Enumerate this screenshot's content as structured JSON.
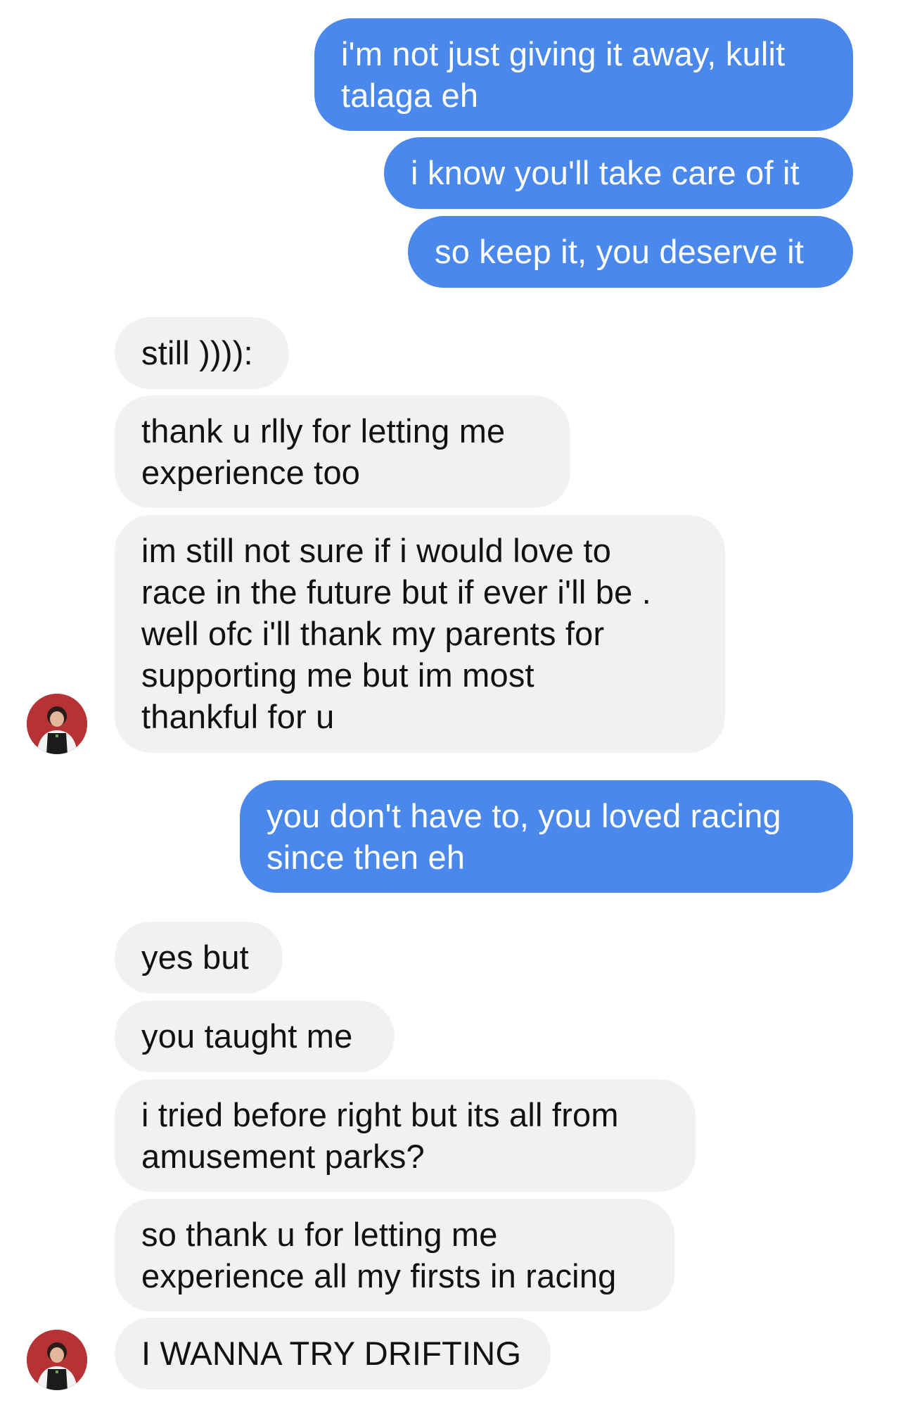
{
  "chat": {
    "messages": [
      {
        "side": "sent",
        "text": "i'm not just giving it away, kulit\ntalaga eh"
      },
      {
        "side": "sent",
        "text": "i know you'll take care of it"
      },
      {
        "side": "sent",
        "text": "so keep it, you deserve it"
      },
      {
        "side": "received",
        "text": "still )))):"
      },
      {
        "side": "received",
        "text": "thank u rlly for letting me\nexperience too"
      },
      {
        "side": "received",
        "text": "im still not sure if i would love to\nrace in the future but if ever i'll be .\nwell ofc i'll thank my parents for\nsupporting me but im most\nthankful for u"
      },
      {
        "side": "sent",
        "text": "you don't have to, you loved racing\nsince then eh"
      },
      {
        "side": "received",
        "text": "yes but"
      },
      {
        "side": "received",
        "text": "you taught me"
      },
      {
        "side": "received",
        "text": "i tried before right but its all from\namusement parks?"
      },
      {
        "side": "received",
        "text": "so thank u for letting me\nexperience all my firsts in racing"
      },
      {
        "side": "received",
        "text": "I WANNA TRY DRIFTING"
      }
    ],
    "avatar_icon": "contact-avatar-photo",
    "colors": {
      "sent_bubble": "#4b88ec",
      "sent_text": "#ffffff",
      "received_bubble": "#f1f1f1",
      "received_text": "#111111",
      "avatar_background": "#b63235"
    }
  }
}
